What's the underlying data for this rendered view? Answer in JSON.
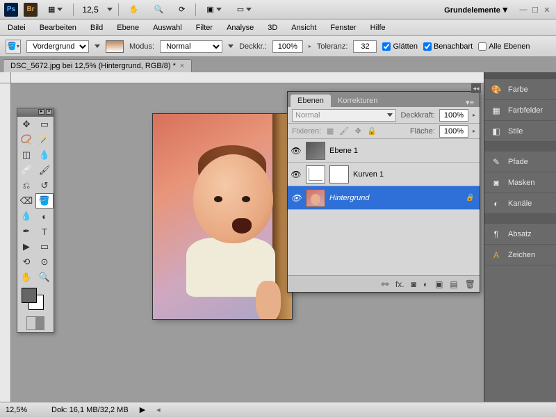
{
  "top": {
    "zoom": "12,5",
    "workspace": "Grundelemente"
  },
  "menu": [
    "Datei",
    "Bearbeiten",
    "Bild",
    "Ebene",
    "Auswahl",
    "Filter",
    "Analyse",
    "3D",
    "Ansicht",
    "Fenster",
    "Hilfe"
  ],
  "options": {
    "fill_label": "Vordergrund",
    "mode_label": "Modus:",
    "mode_value": "Normal",
    "opacity_label": "Deckkr.:",
    "opacity_value": "100%",
    "tolerance_label": "Toleranz:",
    "tolerance_value": "32",
    "antialias": "Glätten",
    "contiguous": "Benachbart",
    "all_layers": "Alle Ebenen"
  },
  "doc_tab": "DSC_5672.jpg bei 12,5% (Hintergrund, RGB/8) *",
  "layers": {
    "tab_layers": "Ebenen",
    "tab_adjust": "Korrekturen",
    "blend_mode": "Normal",
    "opacity_label": "Deckkraft:",
    "opacity_value": "100%",
    "lock_label": "Fixieren:",
    "fill_label": "Fläche:",
    "fill_value": "100%",
    "rows": [
      {
        "name": "Ebene 1"
      },
      {
        "name": "Kurven 1"
      },
      {
        "name": "Hintergrund"
      }
    ]
  },
  "dock": [
    "Farbe",
    "Farbfelder",
    "Stile",
    "Pfade",
    "Masken",
    "Kanäle",
    "Absatz",
    "Zeichen"
  ],
  "status": {
    "zoom": "12,5%",
    "doc_label": "Dok:",
    "doc_value": "16,1 MB/32,2 MB"
  }
}
